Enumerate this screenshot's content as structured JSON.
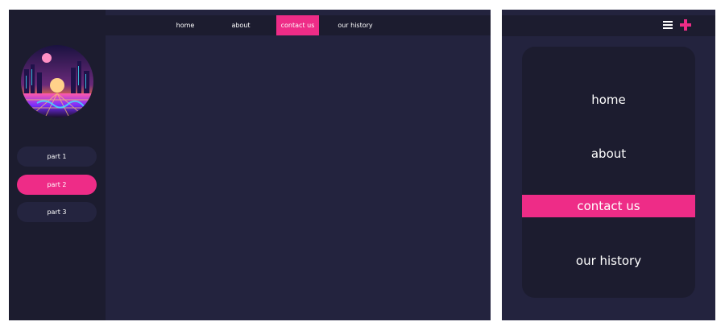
{
  "colors": {
    "background": "#23233e",
    "sidebar": "#1c1c2f",
    "accent": "#ee2c87",
    "text": "#ffffff"
  },
  "nav": {
    "items": [
      {
        "label": "home",
        "active": false
      },
      {
        "label": "about",
        "active": false
      },
      {
        "label": "contact us",
        "active": true
      },
      {
        "label": "our history",
        "active": false
      }
    ]
  },
  "sidebar": {
    "avatar": "synthwave-landscape-image",
    "parts": [
      {
        "label": "part 1",
        "active": false
      },
      {
        "label": "part 2",
        "active": true
      },
      {
        "label": "part 3",
        "active": false
      }
    ]
  },
  "mobile": {
    "icons": [
      "hamburger-menu-icon",
      "plus-icon"
    ],
    "menu": [
      {
        "label": "home",
        "active": false
      },
      {
        "label": "about",
        "active": false
      },
      {
        "label": "contact us",
        "active": true
      },
      {
        "label": "our history",
        "active": false
      }
    ]
  }
}
